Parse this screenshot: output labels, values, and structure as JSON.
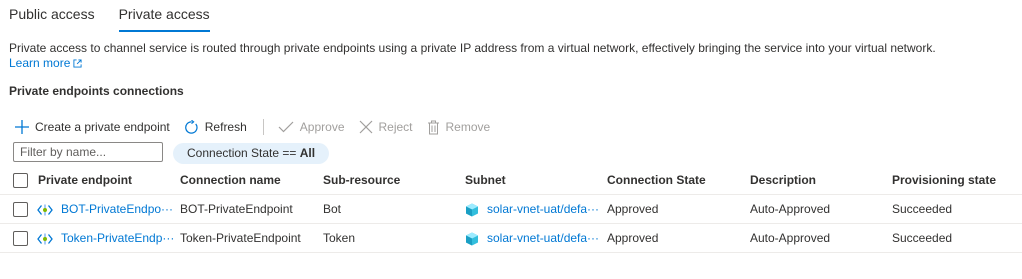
{
  "tabs": [
    {
      "label": "Public access",
      "active": false
    },
    {
      "label": "Private access",
      "active": true
    }
  ],
  "description": "Private access to channel service is routed through private endpoints using a private IP address from a virtual network, effectively bringing the service into your virtual network.",
  "learn_more": "Learn more",
  "section_title": "Private endpoints connections",
  "toolbar": {
    "create": "Create a private endpoint",
    "refresh": "Refresh",
    "approve": "Approve",
    "reject": "Reject",
    "remove": "Remove"
  },
  "filter": {
    "placeholder": "Filter by name...",
    "value": ""
  },
  "pill": {
    "prefix": "Connection State == ",
    "value": "All"
  },
  "columns": [
    "Private endpoint",
    "Connection name",
    "Sub-resource",
    "Subnet",
    "Connection State",
    "Description",
    "Provisioning state"
  ],
  "rows": [
    {
      "endpoint": "BOT-PrivateEndpo···",
      "connection_name": "BOT-PrivateEndpoint",
      "sub_resource": "Bot",
      "subnet": "solar-vnet-uat/defa···",
      "state": "Approved",
      "description": "Auto-Approved",
      "provisioning": "Succeeded"
    },
    {
      "endpoint": "Token-PrivateEndp···",
      "connection_name": "Token-PrivateEndpoint",
      "sub_resource": "Token",
      "subnet": "solar-vnet-uat/defa···",
      "state": "Approved",
      "description": "Auto-Approved",
      "provisioning": "Succeeded"
    }
  ],
  "colors": {
    "accent": "#0078d4",
    "pill_bg": "#e5f1fb",
    "disabled": "#a19f9d"
  },
  "icons": [
    "add-icon",
    "refresh-icon",
    "checkmark-icon",
    "close-icon",
    "trash-icon",
    "private-endpoint-icon",
    "subnet-icon",
    "external-link-icon"
  ]
}
